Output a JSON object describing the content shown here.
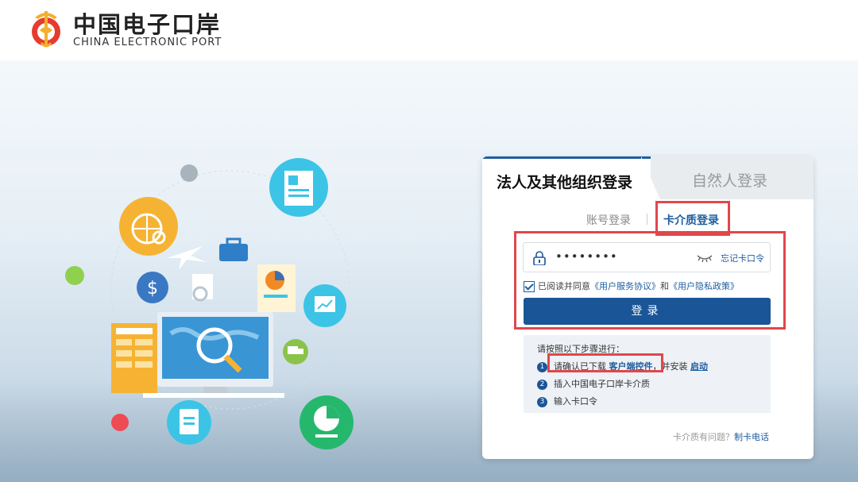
{
  "brand": {
    "name_cn": "中国电子口岸",
    "name_en": "CHINA ELECTRONIC PORT"
  },
  "tabs": {
    "active": "法人及其他组织登录",
    "inactive": "自然人登录"
  },
  "subtabs": {
    "account": "账号登录",
    "card": "卡介质登录"
  },
  "form": {
    "password_value": "••••••••",
    "forgot_label": "忘记卡口令",
    "agree_prefix": "已阅读并同意",
    "service_link": "《用户服务协议》",
    "and": "和",
    "privacy_link": "《用户隐私政策》",
    "login_label": "登录"
  },
  "steps": {
    "title": "请按照以下步骤进行：",
    "items": [
      {
        "num": "1",
        "text_before": "请确认已下载 ",
        "link": "客户端控件",
        "text_mid": "，并安装 ",
        "link2": "启动"
      },
      {
        "num": "2",
        "text": "插入中国电子口岸卡介质"
      },
      {
        "num": "3",
        "text": "输入卡口令"
      }
    ]
  },
  "help": {
    "question": "卡介质有问题？",
    "link": "制卡电话"
  },
  "colors": {
    "primary": "#1a5597",
    "highlight_red": "#e0474c"
  }
}
